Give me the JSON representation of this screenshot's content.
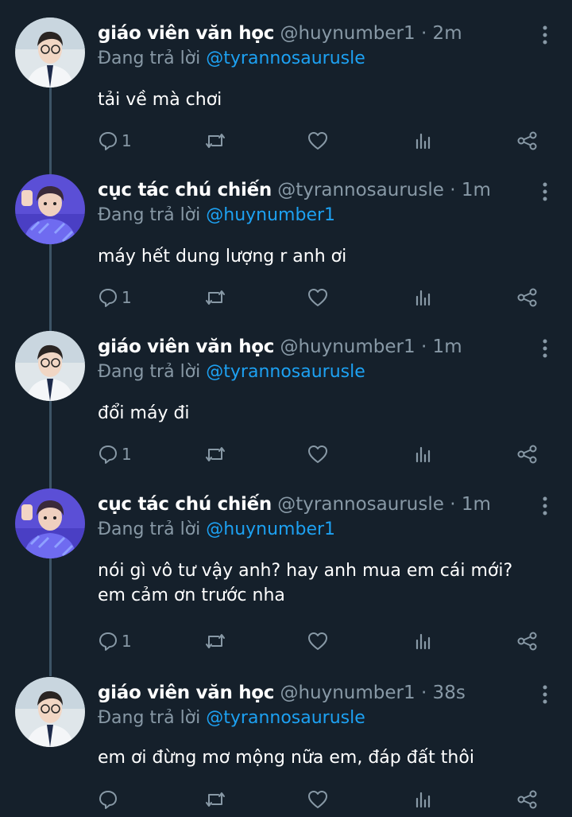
{
  "tweets": [
    {
      "avatar": "avatar-boy-glasses",
      "name": "giáo viên văn học",
      "handle": "@huynumber1",
      "time": "· 2m",
      "reply_prefix": "Đang trả lời",
      "reply_to": "@tyrannosaurusle",
      "lines": [
        "tải về mà chơi"
      ],
      "reply_count": "1"
    },
    {
      "avatar": "avatar-boy-purple",
      "name": "cục tác chú chiến",
      "handle": "@tyrannosaurusle",
      "time": "· 1m",
      "reply_prefix": "Đang trả lời",
      "reply_to": "@huynumber1",
      "lines": [
        "máy hết dung lượng r anh ơi"
      ],
      "reply_count": "1"
    },
    {
      "avatar": "avatar-boy-glasses",
      "name": "giáo viên văn học",
      "handle": "@huynumber1",
      "time": "· 1m",
      "reply_prefix": "Đang trả lời",
      "reply_to": "@tyrannosaurusle",
      "lines": [
        "đổi máy đi"
      ],
      "reply_count": "1"
    },
    {
      "avatar": "avatar-boy-purple",
      "name": "cục tác chú chiến",
      "handle": "@tyrannosaurusle",
      "time": "· 1m",
      "reply_prefix": "Đang trả lời",
      "reply_to": "@huynumber1",
      "lines": [
        "nói gì vô tư vậy anh? hay anh mua em cái mới?",
        "em cảm ơn trước nha"
      ],
      "reply_count": "1"
    },
    {
      "avatar": "avatar-boy-glasses",
      "name": "giáo viên văn học",
      "handle": "@huynumber1",
      "time": "· 38s",
      "reply_prefix": "Đang trả lời",
      "reply_to": "@tyrannosaurusle",
      "lines": [
        "em ơi đừng mơ mộng nữa em, đáp đất thôi"
      ],
      "reply_count": ""
    }
  ],
  "icons": {
    "reply": "reply-icon",
    "retweet": "retweet-icon",
    "like": "heart-icon",
    "analytics": "analytics-icon",
    "share": "share-icon",
    "menu": "more-vertical-icon"
  },
  "colors": {
    "background": "#15202b",
    "name": "#ffffff",
    "secondary": "#8899a6",
    "mention": "#1da1f2",
    "thread_line": "#3d5466"
  }
}
